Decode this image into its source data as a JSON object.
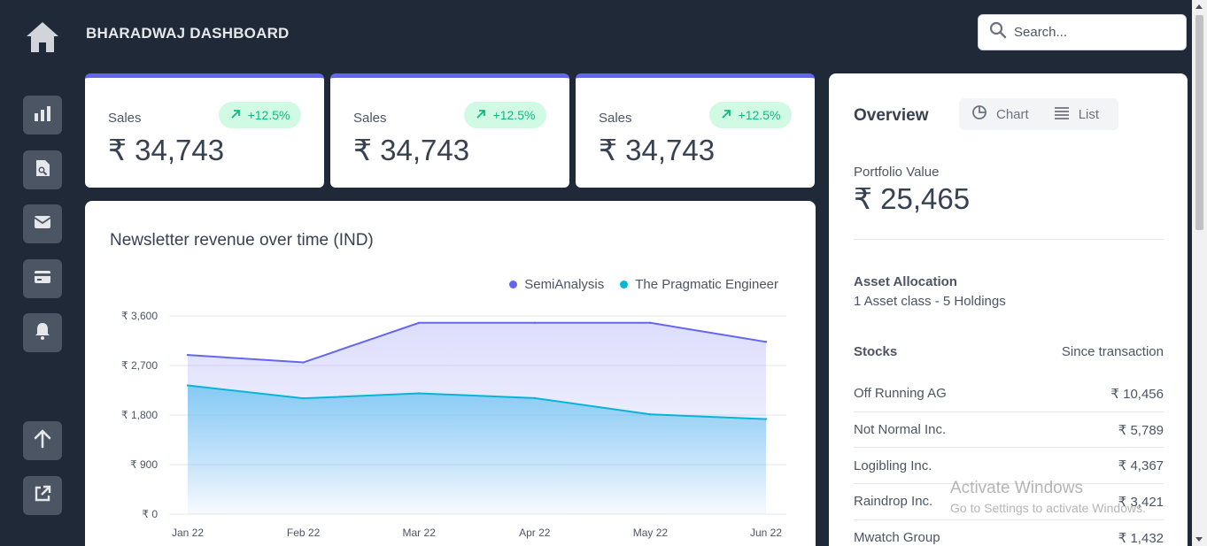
{
  "header": {
    "brand": "BHARADWAJ DASHBOARD",
    "search_placeholder": "Search..."
  },
  "sidebar": {
    "items": [
      {
        "icon": "bar-chart-icon"
      },
      {
        "icon": "document-search-icon"
      },
      {
        "icon": "mail-icon"
      },
      {
        "icon": "credit-card-icon"
      },
      {
        "icon": "bell-icon"
      }
    ],
    "bottom": [
      {
        "icon": "arrow-up-icon"
      },
      {
        "icon": "external-link-icon"
      }
    ]
  },
  "stats": [
    {
      "label": "Sales",
      "value": "₹ 34,743",
      "change": "+12.5%"
    },
    {
      "label": "Sales",
      "value": "₹ 34,743",
      "change": "+12.5%"
    },
    {
      "label": "Sales",
      "value": "₹ 34,743",
      "change": "+12.5%"
    }
  ],
  "chart": {
    "title": "Newsletter revenue over time (IND)"
  },
  "chart_data": {
    "type": "area",
    "title": "Newsletter revenue over time (IND)",
    "categories": [
      "Jan 22",
      "Feb 22",
      "Mar 22",
      "Apr 22",
      "May 22",
      "Jun 22"
    ],
    "y_ticks": [
      "₹ 0",
      "₹ 900",
      "₹ 1,800",
      "₹ 2,700",
      "₹ 3,600"
    ],
    "ylim": [
      0,
      3600
    ],
    "grid": true,
    "legend_position": "top-right",
    "series": [
      {
        "name": "SemiAnalysis",
        "color": "#6366f1",
        "values": [
          2890,
          2756,
          3475,
          3475,
          3475,
          3129
        ]
      },
      {
        "name": "The Pragmatic Engineer",
        "color": "#06b6d4",
        "values": [
          2338,
          2103,
          2194,
          2108,
          1812,
          1726
        ]
      }
    ]
  },
  "overview": {
    "title": "Overview",
    "toggle_chart": "Chart",
    "toggle_list": "List",
    "portfolio_label": "Portfolio Value",
    "portfolio_value": "₹ 25,465",
    "asset_title": "Asset Allocation",
    "asset_sub": "1 Asset class - 5 Holdings",
    "stocks_header": "Stocks",
    "since_header": "Since transaction",
    "stocks": [
      {
        "name": "Off Running AG",
        "value": "₹ 10,456"
      },
      {
        "name": "Not Normal Inc.",
        "value": "₹ 5,789"
      },
      {
        "name": "Logibling Inc.",
        "value": "₹ 4,367"
      },
      {
        "name": "Raindrop Inc.",
        "value": "₹ 3,421"
      },
      {
        "name": "Mwatch Group",
        "value": "₹ 1,432"
      }
    ]
  },
  "watermark": {
    "line1": "Activate Windows",
    "line2": "Go to Settings to activate Windows."
  }
}
